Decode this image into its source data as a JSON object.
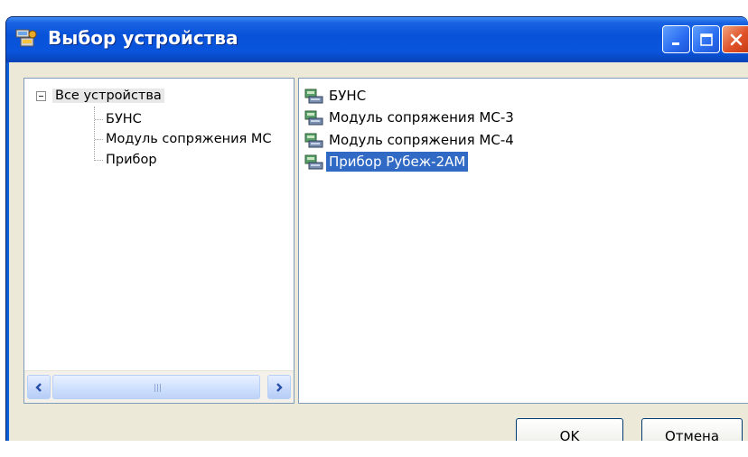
{
  "window": {
    "title": "Выбор устройства",
    "title_icon": "devices-app-icon",
    "controls": [
      "minimize-icon",
      "maximize-icon",
      "close-icon"
    ]
  },
  "tree": {
    "root_label": "Все устройства",
    "expanded": true,
    "children": [
      {
        "label": "БУНС"
      },
      {
        "label": "Модуль сопряжения МС"
      },
      {
        "label": "Прибор"
      }
    ]
  },
  "device_list": {
    "items": [
      {
        "label": "БУНС",
        "selected": false,
        "icon": "device-icon"
      },
      {
        "label": "Модуль сопряжения МС-3",
        "selected": false,
        "icon": "device-icon"
      },
      {
        "label": "Модуль сопряжения МС-4",
        "selected": false,
        "icon": "device-icon"
      },
      {
        "label": "Прибор Рубеж-2АМ",
        "selected": true,
        "icon": "device-icon"
      }
    ]
  },
  "buttons": {
    "ok_label": "OK",
    "cancel_label": "Отмена"
  },
  "colors": {
    "titlebar": "#0852d9",
    "selection": "#316ac5",
    "dialog_face": "#ece9d8",
    "close_button": "#e0522a"
  }
}
